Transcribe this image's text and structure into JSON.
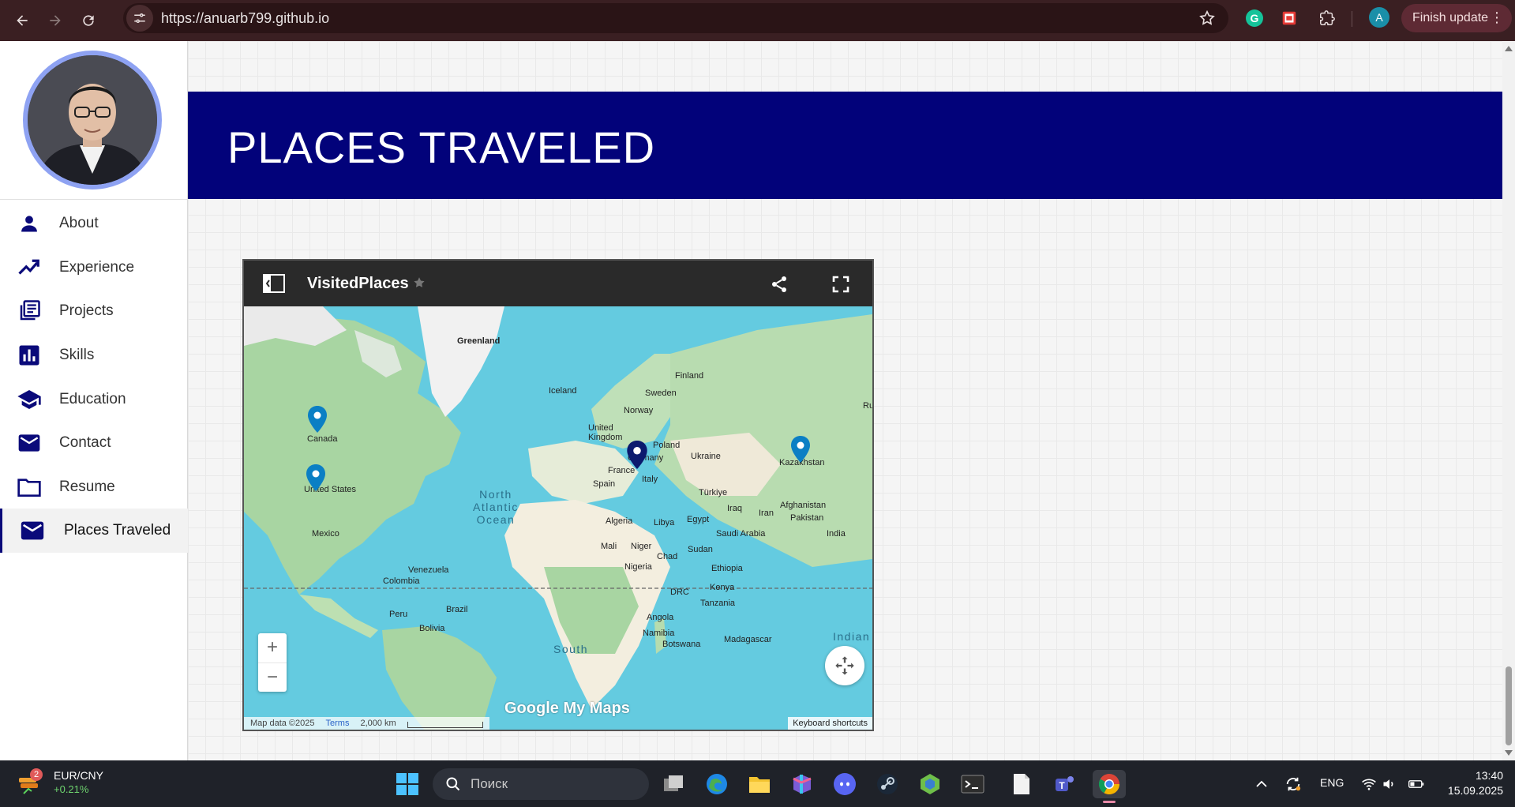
{
  "browser": {
    "url": "https://anuarb799.github.io",
    "profile_initial": "A",
    "finish_update_label": "Finish update"
  },
  "sidebar": {
    "items": [
      {
        "label": "About",
        "icon": "person-icon"
      },
      {
        "label": "Experience",
        "icon": "trending-up-icon"
      },
      {
        "label": "Projects",
        "icon": "library-books-icon"
      },
      {
        "label": "Skills",
        "icon": "bar-chart-icon"
      },
      {
        "label": "Education",
        "icon": "school-icon"
      },
      {
        "label": "Contact",
        "icon": "mail-icon"
      },
      {
        "label": "Resume",
        "icon": "folder-icon"
      },
      {
        "label": "Places Traveled",
        "icon": "mail-icon",
        "active": true
      }
    ]
  },
  "banner": {
    "title": "PLACES TRAVELED"
  },
  "map": {
    "title": "VisitedPlaces",
    "labels": {
      "greenland": "Greenland",
      "iceland": "Iceland",
      "finland": "Finland",
      "sweden": "Sweden",
      "norway": "Norway",
      "uk": "United Kingdom",
      "poland": "Poland",
      "germany": "Germany",
      "ukraine": "Ukraine",
      "france": "France",
      "italy": "Italy",
      "spain": "Spain",
      "turkiye": "Türkiye",
      "kazakhstan": "Kazakhstan",
      "afghanistan": "Afghanistan",
      "iraq": "Iraq",
      "iran": "Iran",
      "pakistan": "Pakistan",
      "india": "India",
      "saudi": "Saudi Arabia",
      "egypt": "Egypt",
      "libya": "Libya",
      "algeria": "Algeria",
      "mali": "Mali",
      "niger": "Niger",
      "chad": "Chad",
      "sudan": "Sudan",
      "nigeria": "Nigeria",
      "ethiopia": "Ethiopia",
      "kenya": "Kenya",
      "drc": "DRC",
      "tanzania": "Tanzania",
      "angola": "Angola",
      "namibia": "Namibia",
      "botswana": "Botswana",
      "madagascar": "Madagascar",
      "canada": "Canada",
      "us": "United States",
      "mexico": "Mexico",
      "venezuela": "Venezuela",
      "colombia": "Colombia",
      "peru": "Peru",
      "brazil": "Brazil",
      "bolivia": "Bolivia",
      "russia_partial": "Ru",
      "ocean_na": "North\nAtlantic\nOcean",
      "ocean_south": "South",
      "ocean_indian": "Indian"
    },
    "logo_text": "Google My Maps",
    "attribution": "Map data ©2025",
    "terms": "Terms",
    "scale": "2,000 km",
    "keyboard_shortcuts": "Keyboard shortcuts",
    "zoom_in": "+",
    "zoom_out": "−"
  },
  "taskbar": {
    "widget_pair": "EUR/CNY",
    "widget_change": "+0.21%",
    "widget_badge": "2",
    "search_placeholder": "Поиск",
    "language": "ENG",
    "time": "13:40",
    "date": "15.09.2025"
  }
}
